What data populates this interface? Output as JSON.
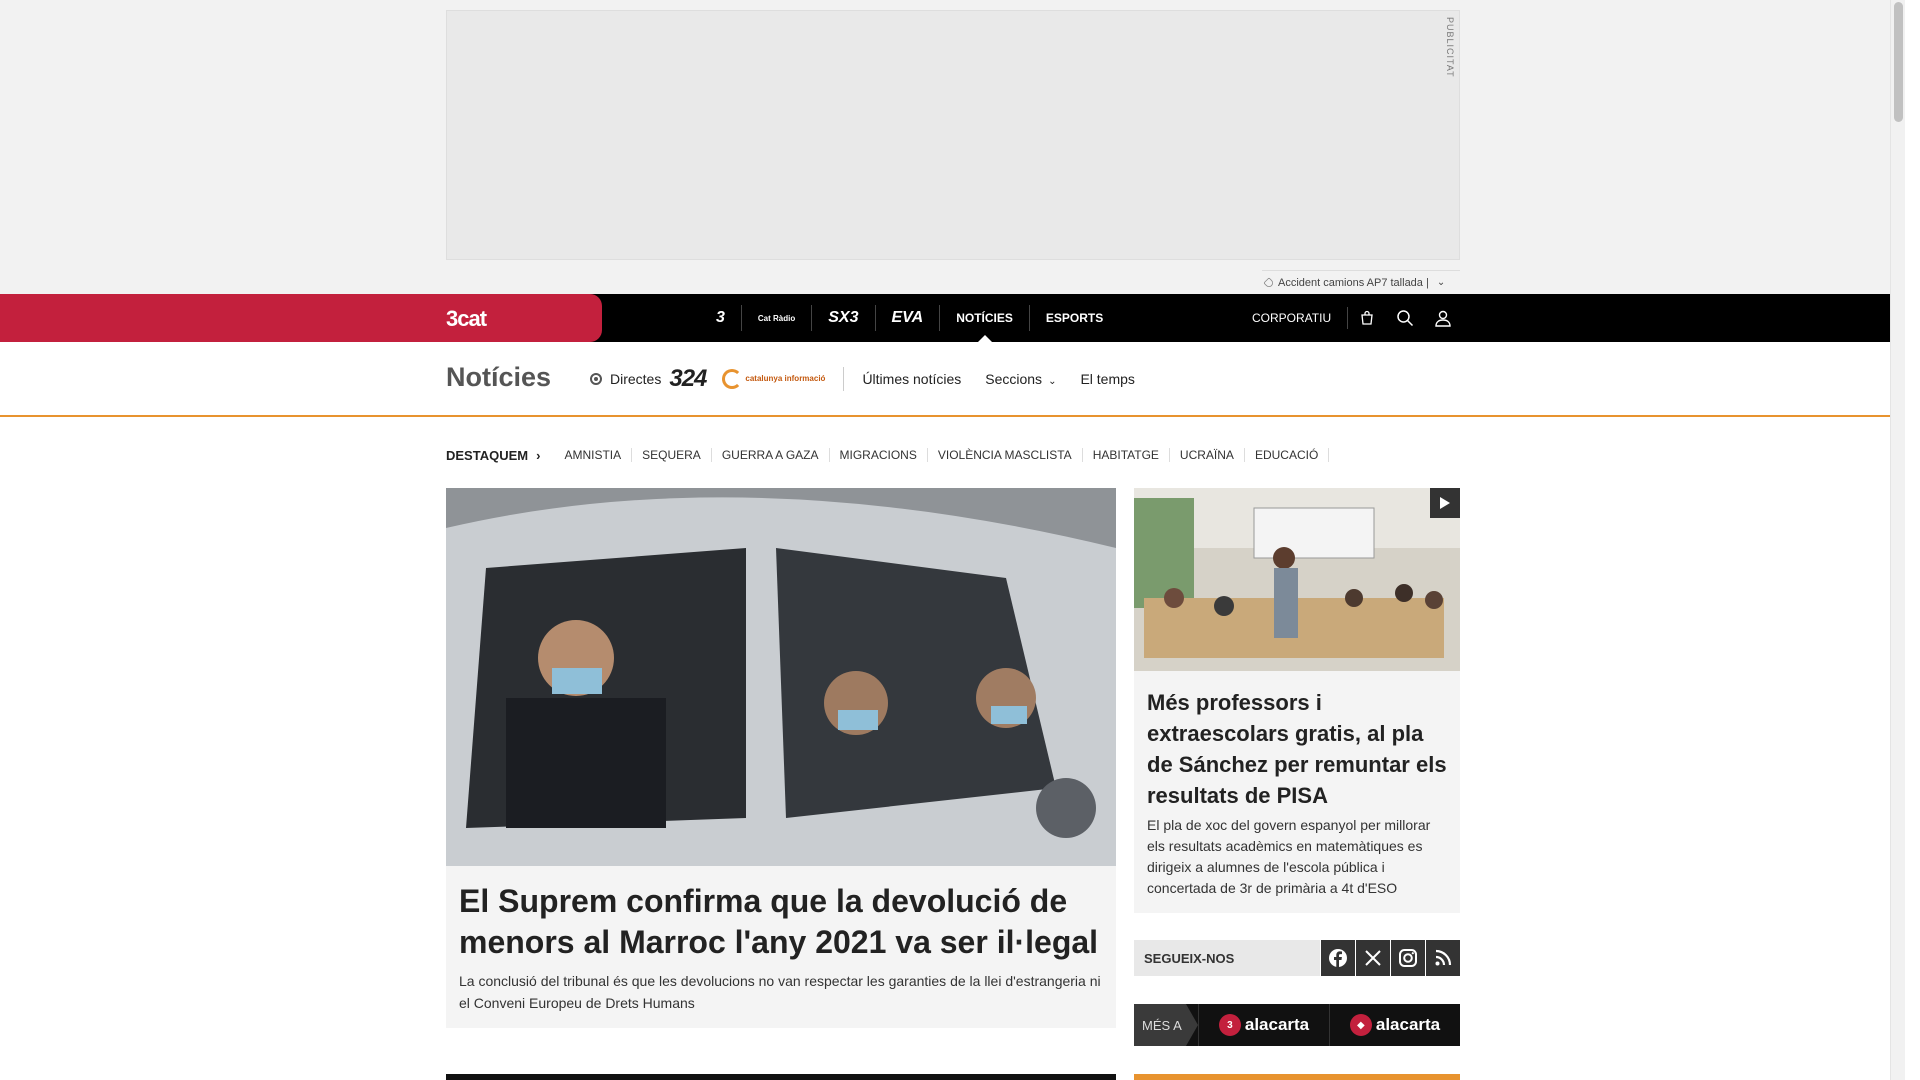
{
  "ad": {
    "label": "PUBLICITAT"
  },
  "ticker": {
    "text": "Accident camions AP7 tallada |"
  },
  "topbar": {
    "logo": "3cat",
    "channels": [
      "3",
      "Cat Ràdio",
      "SX3",
      "EVA"
    ],
    "nav": [
      "NOTÍCIES",
      "ESPORTS"
    ],
    "corporate": "CORPORATIU"
  },
  "section": {
    "title": "Notícies",
    "live_label": "Directes",
    "logo_324": "324",
    "logo_ci": "catalunya informació",
    "links": [
      "Últimes notícies",
      "Seccions",
      "El temps"
    ]
  },
  "tags": {
    "lead": "DESTAQUEM",
    "items": [
      "AMNISTIA",
      "SEQUERA",
      "GUERRA A GAZA",
      "MIGRACIONS",
      "VIOLÈNCIA MASCLISTA",
      "HABITATGE",
      "UCRAÏNA",
      "EDUCACIÓ"
    ]
  },
  "main_article": {
    "title": "El Suprem confirma que la devolució de menors al Marroc l'any 2021 va ser il·legal",
    "description": "La conclusió del tribunal és que les devolucions no van respectar les garanties de la llei d'estrangeria ni el Conveni Europeu de Drets Humans"
  },
  "side_article": {
    "title": "Més professors i extraescolars gratis, al pla de Sánchez per remuntar els resultats de PISA",
    "description": "El pla de xoc del govern espanyol per millorar els resultats acadèmics en matemàtiques es dirigeix a alumnes de l'escola pública i concertada de 3r de primària a 4t d'ESO"
  },
  "follow": {
    "label": "SEGUEIX-NOS",
    "networks": [
      "facebook-icon",
      "x-icon",
      "instagram-icon",
      "rss-icon"
    ]
  },
  "more": {
    "label": "MÉS A",
    "items": [
      "alacarta",
      "alacarta"
    ],
    "badges": [
      "3",
      "◆"
    ]
  },
  "colors": {
    "brand": "#c3203d",
    "accent": "#e8932f"
  }
}
